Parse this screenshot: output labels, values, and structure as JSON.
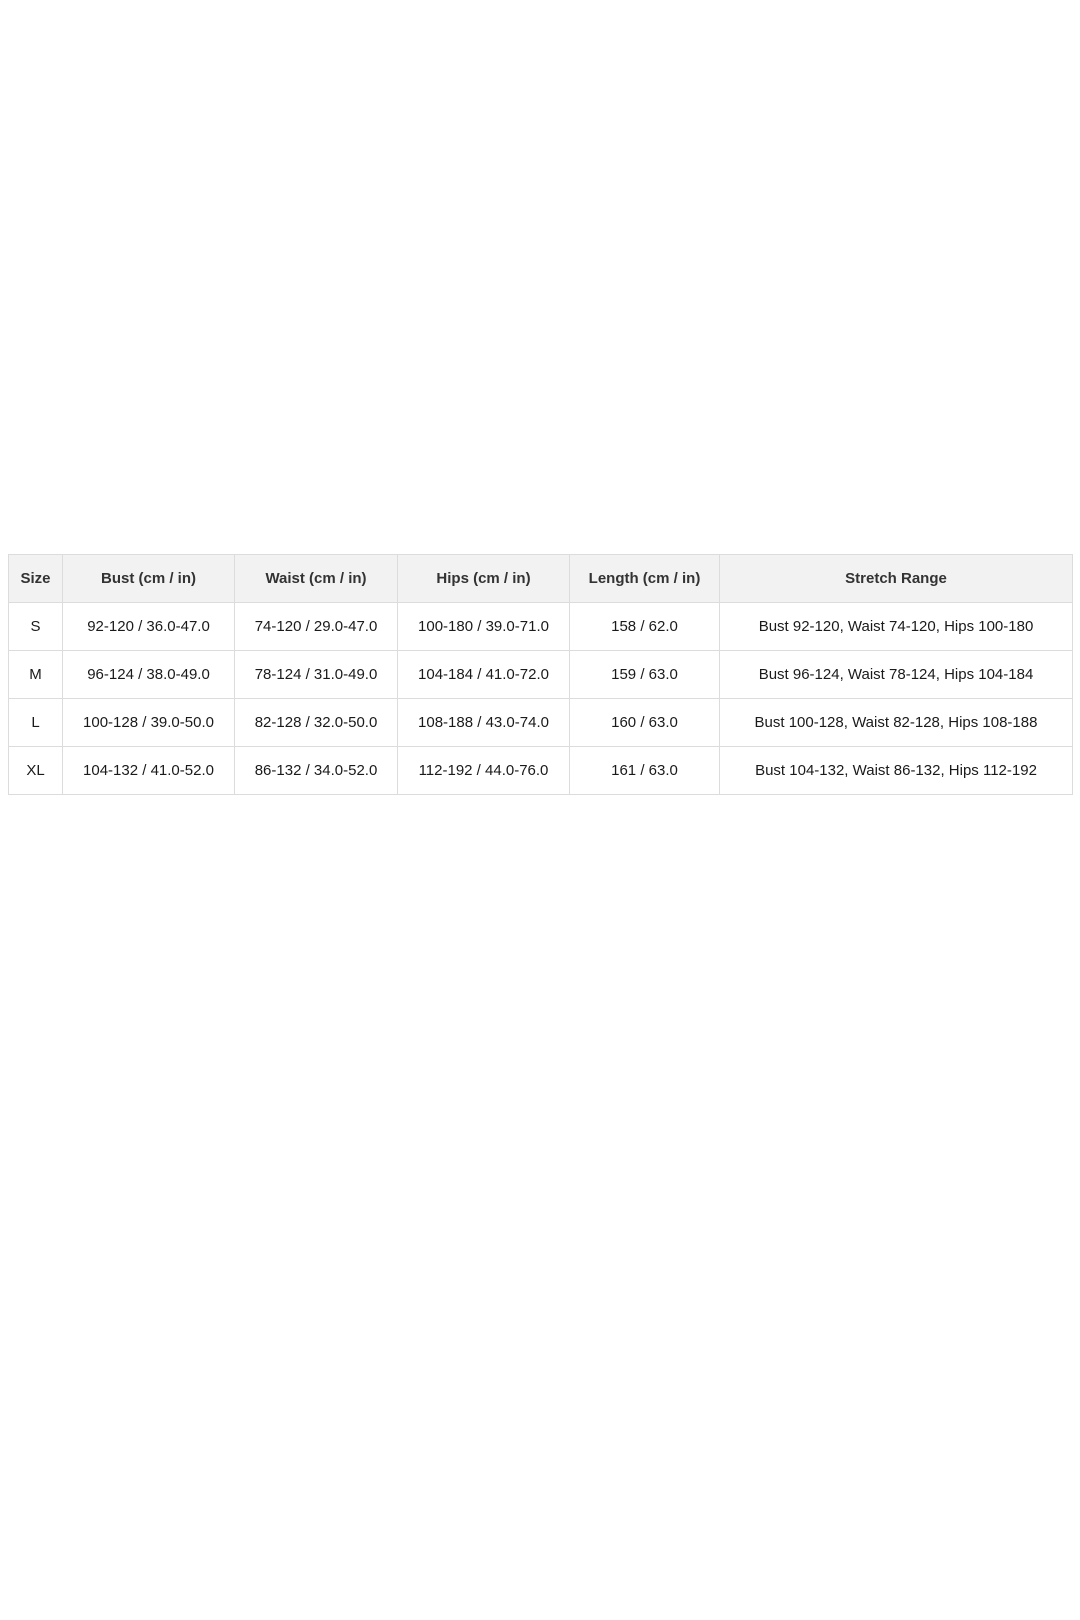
{
  "size_chart": {
    "headers": [
      "Size",
      "Bust (cm / in)",
      "Waist (cm / in)",
      "Hips (cm / in)",
      "Length (cm / in)",
      "Stretch Range"
    ],
    "rows": [
      [
        "S",
        "92-120 / 36.0-47.0",
        "74-120 / 29.0-47.0",
        "100-180 / 39.0-71.0",
        "158 / 62.0",
        "Bust 92-120, Waist 74-120, Hips 100-180"
      ],
      [
        "M",
        "96-124 / 38.0-49.0",
        "78-124 / 31.0-49.0",
        "104-184 / 41.0-72.0",
        "159 / 63.0",
        "Bust 96-124, Waist 78-124, Hips 104-184"
      ],
      [
        "L",
        "100-128 / 39.0-50.0",
        "82-128 / 32.0-50.0",
        "108-188 / 43.0-74.0",
        "160 / 63.0",
        "Bust 100-128, Waist 82-128, Hips 108-188"
      ],
      [
        "XL",
        "104-132 / 41.0-52.0",
        "86-132 / 34.0-52.0",
        "112-192 / 44.0-76.0",
        "161 / 63.0",
        "Bust 104-132, Waist 86-132, Hips 112-192"
      ]
    ]
  },
  "colors": {
    "header_background": "#f2f2f2",
    "border": "#dcdcdc",
    "text": "#1a1a1a"
  }
}
